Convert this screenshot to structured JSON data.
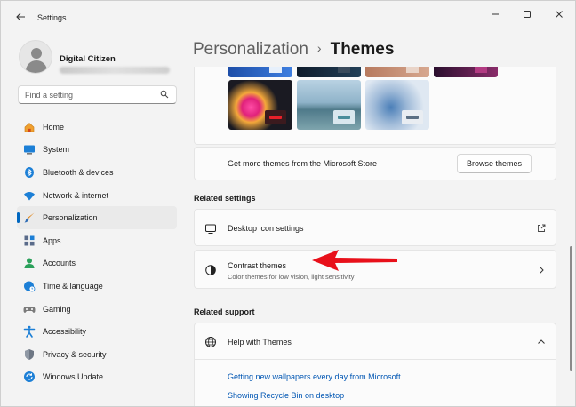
{
  "window": {
    "app_title": "Settings",
    "controls": {
      "minimize": "—",
      "maximize": "☐",
      "close": "✕"
    }
  },
  "profile": {
    "name": "Digital Citizen"
  },
  "search": {
    "placeholder": "Find a setting"
  },
  "nav": {
    "items": [
      {
        "label": "Home",
        "icon": "home-icon"
      },
      {
        "label": "System",
        "icon": "system-icon"
      },
      {
        "label": "Bluetooth & devices",
        "icon": "bluetooth-icon"
      },
      {
        "label": "Network & internet",
        "icon": "wifi-icon"
      },
      {
        "label": "Personalization",
        "icon": "brush-icon",
        "active": true
      },
      {
        "label": "Apps",
        "icon": "apps-icon"
      },
      {
        "label": "Accounts",
        "icon": "accounts-icon"
      },
      {
        "label": "Time & language",
        "icon": "globe-clock-icon"
      },
      {
        "label": "Gaming",
        "icon": "gamepad-icon"
      },
      {
        "label": "Accessibility",
        "icon": "accessibility-icon"
      },
      {
        "label": "Privacy & security",
        "icon": "shield-icon"
      },
      {
        "label": "Windows Update",
        "icon": "update-icon"
      }
    ]
  },
  "breadcrumb": {
    "parent": "Personalization",
    "separator": "›",
    "current": "Themes"
  },
  "themes": {
    "store_text": "Get more themes from the Microsoft Store",
    "browse_label": "Browse themes"
  },
  "related_settings": {
    "title": "Related settings",
    "desktop_icons": {
      "label": "Desktop icon settings",
      "icon": "monitor-icon"
    },
    "contrast": {
      "label": "Contrast themes",
      "sublabel": "Color themes for low vision, light sensitivity",
      "icon": "contrast-icon"
    }
  },
  "related_support": {
    "title": "Related support",
    "help": {
      "label": "Help with Themes",
      "icon": "globe-icon"
    },
    "links": [
      "Getting new wallpapers every day from Microsoft",
      "Showing Recycle Bin on desktop"
    ]
  },
  "colors": {
    "accent": "#0067c0",
    "annotation_arrow": "#e8101a"
  }
}
